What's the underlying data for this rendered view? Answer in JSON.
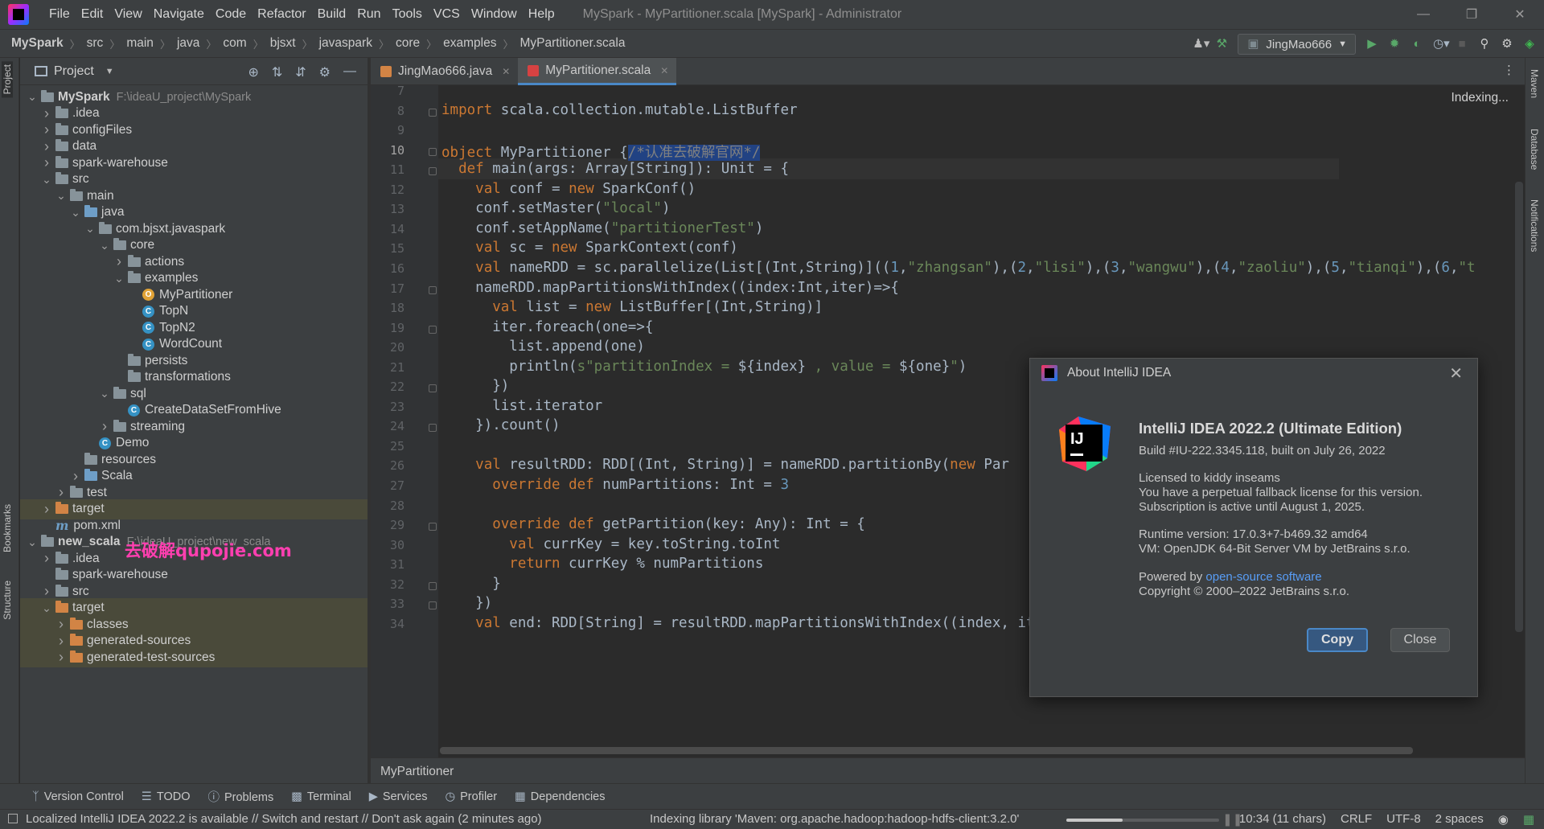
{
  "window": {
    "title": "MySpark - MyPartitioner.scala [MySpark] - Administrator",
    "menu": [
      "File",
      "Edit",
      "View",
      "Navigate",
      "Code",
      "Refactor",
      "Build",
      "Run",
      "Tools",
      "VCS",
      "Window",
      "Help"
    ]
  },
  "nav": {
    "breadcrumbs": [
      "MySpark",
      "src",
      "main",
      "java",
      "com",
      "bjsxt",
      "javaspark",
      "core",
      "examples",
      "MyPartitioner.scala"
    ],
    "run_config": "JingMao666"
  },
  "left_strip": {
    "project": "Project",
    "bookmarks": "Bookmarks",
    "structure": "Structure"
  },
  "right_strip": {
    "maven": "Maven",
    "database": "Database",
    "notifications": "Notifications"
  },
  "project_panel": {
    "title": "Project"
  },
  "tree": [
    {
      "label": "MySpark",
      "path": "F:\\ideaU_project\\MySpark",
      "depth": 0,
      "arrow": "v",
      "icon": "module"
    },
    {
      "label": ".idea",
      "depth": 1,
      "arrow": ">",
      "icon": "folder"
    },
    {
      "label": "configFiles",
      "depth": 1,
      "arrow": ">",
      "icon": "folder"
    },
    {
      "label": "data",
      "depth": 1,
      "arrow": ">",
      "icon": "folder"
    },
    {
      "label": "spark-warehouse",
      "depth": 1,
      "arrow": ">",
      "icon": "folder"
    },
    {
      "label": "src",
      "depth": 1,
      "arrow": "v",
      "icon": "folder"
    },
    {
      "label": "main",
      "depth": 2,
      "arrow": "v",
      "icon": "folder"
    },
    {
      "label": "java",
      "depth": 3,
      "arrow": "v",
      "icon": "folder-blue"
    },
    {
      "label": "com.bjsxt.javaspark",
      "depth": 4,
      "arrow": "v",
      "icon": "package"
    },
    {
      "label": "core",
      "depth": 5,
      "arrow": "v",
      "icon": "package"
    },
    {
      "label": "actions",
      "depth": 6,
      "arrow": ">",
      "icon": "package"
    },
    {
      "label": "examples",
      "depth": 6,
      "arrow": "v",
      "icon": "package"
    },
    {
      "label": "MyPartitioner",
      "depth": 7,
      "arrow": "",
      "icon": "scala-object"
    },
    {
      "label": "TopN",
      "depth": 7,
      "arrow": "",
      "icon": "scala-class"
    },
    {
      "label": "TopN2",
      "depth": 7,
      "arrow": "",
      "icon": "scala-class"
    },
    {
      "label": "WordCount",
      "depth": 7,
      "arrow": "",
      "icon": "scala-class"
    },
    {
      "label": "persists",
      "depth": 6,
      "arrow": "",
      "icon": "package"
    },
    {
      "label": "transformations",
      "depth": 6,
      "arrow": "",
      "icon": "package"
    },
    {
      "label": "sql",
      "depth": 5,
      "arrow": "v",
      "icon": "package"
    },
    {
      "label": "CreateDataSetFromHive",
      "depth": 6,
      "arrow": "",
      "icon": "scala-class"
    },
    {
      "label": "streaming",
      "depth": 5,
      "arrow": ">",
      "icon": "package"
    },
    {
      "label": "Demo",
      "depth": 4,
      "arrow": "",
      "icon": "scala-class"
    },
    {
      "label": "resources",
      "depth": 3,
      "arrow": "",
      "icon": "folder"
    },
    {
      "label": "Scala",
      "depth": 3,
      "arrow": ">",
      "icon": "folder-blue"
    },
    {
      "label": "test",
      "depth": 2,
      "arrow": ">",
      "icon": "folder"
    },
    {
      "label": "target",
      "depth": 1,
      "arrow": ">",
      "icon": "folder-orange",
      "hl": true
    },
    {
      "label": "pom.xml",
      "depth": 1,
      "arrow": "",
      "icon": "maven"
    },
    {
      "label": "new_scala",
      "path": "F:\\ideaU_project\\new_scala",
      "depth": 0,
      "arrow": "v",
      "icon": "module"
    },
    {
      "label": ".idea",
      "depth": 1,
      "arrow": ">",
      "icon": "folder"
    },
    {
      "label": "spark-warehouse",
      "depth": 1,
      "arrow": "",
      "icon": "folder"
    },
    {
      "label": "src",
      "depth": 1,
      "arrow": ">",
      "icon": "folder"
    },
    {
      "label": "target",
      "depth": 1,
      "arrow": "v",
      "icon": "folder-orange",
      "hl": true
    },
    {
      "label": "classes",
      "depth": 2,
      "arrow": ">",
      "icon": "folder-orange",
      "hl": true
    },
    {
      "label": "generated-sources",
      "depth": 2,
      "arrow": ">",
      "icon": "folder-orange",
      "hl": true
    },
    {
      "label": "generated-test-sources",
      "depth": 2,
      "arrow": ">",
      "icon": "folder-orange",
      "hl": true
    }
  ],
  "watermark": "去破解qupojie.com",
  "tabs": [
    {
      "label": "JingMao666.java",
      "active": false
    },
    {
      "label": "MyPartitioner.scala",
      "active": true
    }
  ],
  "editor": {
    "indexing": "Indexing...",
    "current_line": 10,
    "lines": [
      {
        "n": 7,
        "code": ""
      },
      {
        "n": 8,
        "code": "import scala.collection.mutable.ListBuffer"
      },
      {
        "n": 9,
        "code": ""
      },
      {
        "n": 10,
        "code": "object MyPartitioner {/*认准去破解官网*/"
      },
      {
        "n": 11,
        "code": "  def main(args: Array[String]): Unit = {"
      },
      {
        "n": 12,
        "code": "    val conf = new SparkConf()"
      },
      {
        "n": 13,
        "code": "    conf.setMaster(\"local\")"
      },
      {
        "n": 14,
        "code": "    conf.setAppName(\"partitionerTest\")"
      },
      {
        "n": 15,
        "code": "    val sc = new SparkContext(conf)"
      },
      {
        "n": 16,
        "code": "    val nameRDD = sc.parallelize(List[(Int,String)]((1,\"zhangsan\"),(2,\"lisi\"),(3,\"wangwu\"),(4,\"zaoliu\"),(5,\"tianqi\"),(6,\"t"
      },
      {
        "n": 17,
        "code": "    nameRDD.mapPartitionsWithIndex((index:Int,iter)=>{"
      },
      {
        "n": 18,
        "code": "      val list = new ListBuffer[(Int,String)]"
      },
      {
        "n": 19,
        "code": "      iter.foreach(one=>{"
      },
      {
        "n": 20,
        "code": "        list.append(one)"
      },
      {
        "n": 21,
        "code": "        println(s\"partitionIndex = ${index} , value = ${one}\")"
      },
      {
        "n": 22,
        "code": "      })"
      },
      {
        "n": 23,
        "code": "      list.iterator"
      },
      {
        "n": 24,
        "code": "    }).count()"
      },
      {
        "n": 25,
        "code": ""
      },
      {
        "n": 26,
        "code": "    val resultRDD: RDD[(Int, String)] = nameRDD.partitionBy(new Par"
      },
      {
        "n": 27,
        "code": "      override def numPartitions: Int = 3"
      },
      {
        "n": 28,
        "code": ""
      },
      {
        "n": 29,
        "code": "      override def getPartition(key: Any): Int = {"
      },
      {
        "n": 30,
        "code": "        val currKey = key.toString.toInt"
      },
      {
        "n": 31,
        "code": "        return currKey % numPartitions"
      },
      {
        "n": 32,
        "code": "      }"
      },
      {
        "n": 33,
        "code": "    })"
      },
      {
        "n": 34,
        "code": "    val end: RDD[String] = resultRDD.mapPartitionsWithIndex((index, iter) => {"
      }
    ],
    "breadcrumb": "MyPartitioner"
  },
  "toolwindows": [
    "Version Control",
    "TODO",
    "Problems",
    "Terminal",
    "Services",
    "Profiler",
    "Dependencies"
  ],
  "status": {
    "left": "Localized IntelliJ IDEA 2022.2 is available // Switch and restart // Don't ask again (2 minutes ago)",
    "indexing": "Indexing library 'Maven: org.apache.hadoop:hadoop-hdfs-client:3.2.0'",
    "progress": 0.37,
    "position": "10:34 (11 chars)",
    "line_sep": "CRLF",
    "encoding": "UTF-8",
    "indent": "2 spaces"
  },
  "dialog": {
    "title": "About IntelliJ IDEA",
    "product": "IntelliJ IDEA 2022.2 (Ultimate Edition)",
    "build": "Build #IU-222.3345.118, built on July 26, 2022",
    "license1": "Licensed to kiddy inseams",
    "license2": "You have a perpetual fallback license for this version.",
    "license3": "Subscription is active until August 1, 2025.",
    "runtime": "Runtime version: 17.0.3+7-b469.32 amd64",
    "vm": "VM: OpenJDK 64-Bit Server VM by JetBrains s.r.o.",
    "powered_by": "Powered by",
    "powered_link": "open-source software",
    "copyright": "Copyright © 2000–2022 JetBrains s.r.o.",
    "copy_label": "Copy",
    "close_label": "Close"
  },
  "colors": {
    "accent": "#4a88c7",
    "keyword": "#cc7832",
    "string": "#6a8759",
    "number": "#6897bb"
  }
}
